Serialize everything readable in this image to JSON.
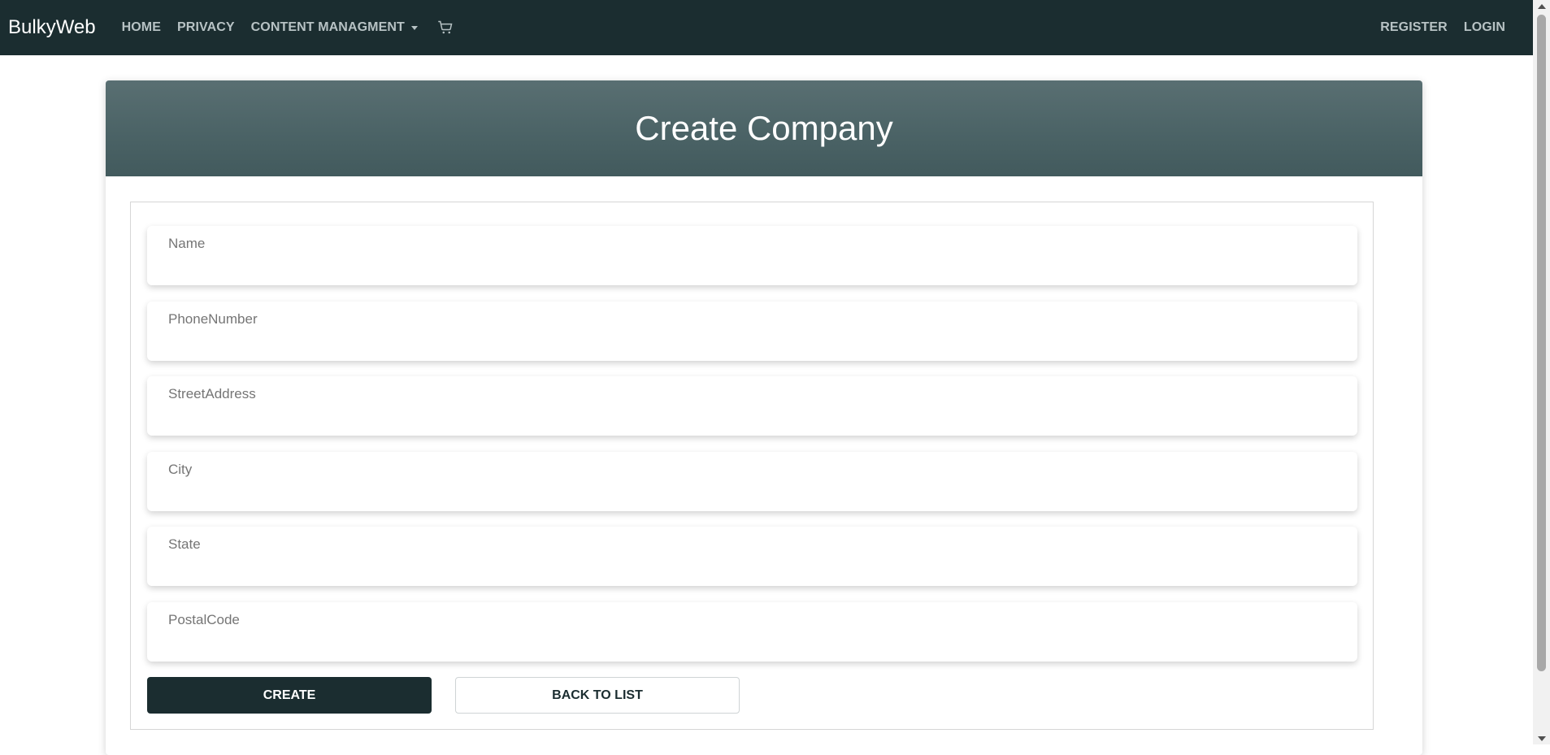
{
  "navbar": {
    "brand": "BulkyWeb",
    "links": [
      {
        "label": "Home"
      },
      {
        "label": "Privacy"
      },
      {
        "label": "Content Managment"
      }
    ],
    "cart_icon": "cart-icon",
    "right_links": [
      {
        "label": "Register"
      },
      {
        "label": "Login"
      }
    ],
    "background": "#1b2d30"
  },
  "card": {
    "title": "Create Company",
    "header_color": "#4a6265"
  },
  "form": {
    "fields": [
      {
        "label": "Name",
        "value": ""
      },
      {
        "label": "PhoneNumber",
        "value": ""
      },
      {
        "label": "StreetAddress",
        "value": ""
      },
      {
        "label": "City",
        "value": ""
      },
      {
        "label": "State",
        "value": ""
      },
      {
        "label": "PostalCode",
        "value": ""
      }
    ],
    "create_label": "Create",
    "back_label": "Back to List"
  }
}
